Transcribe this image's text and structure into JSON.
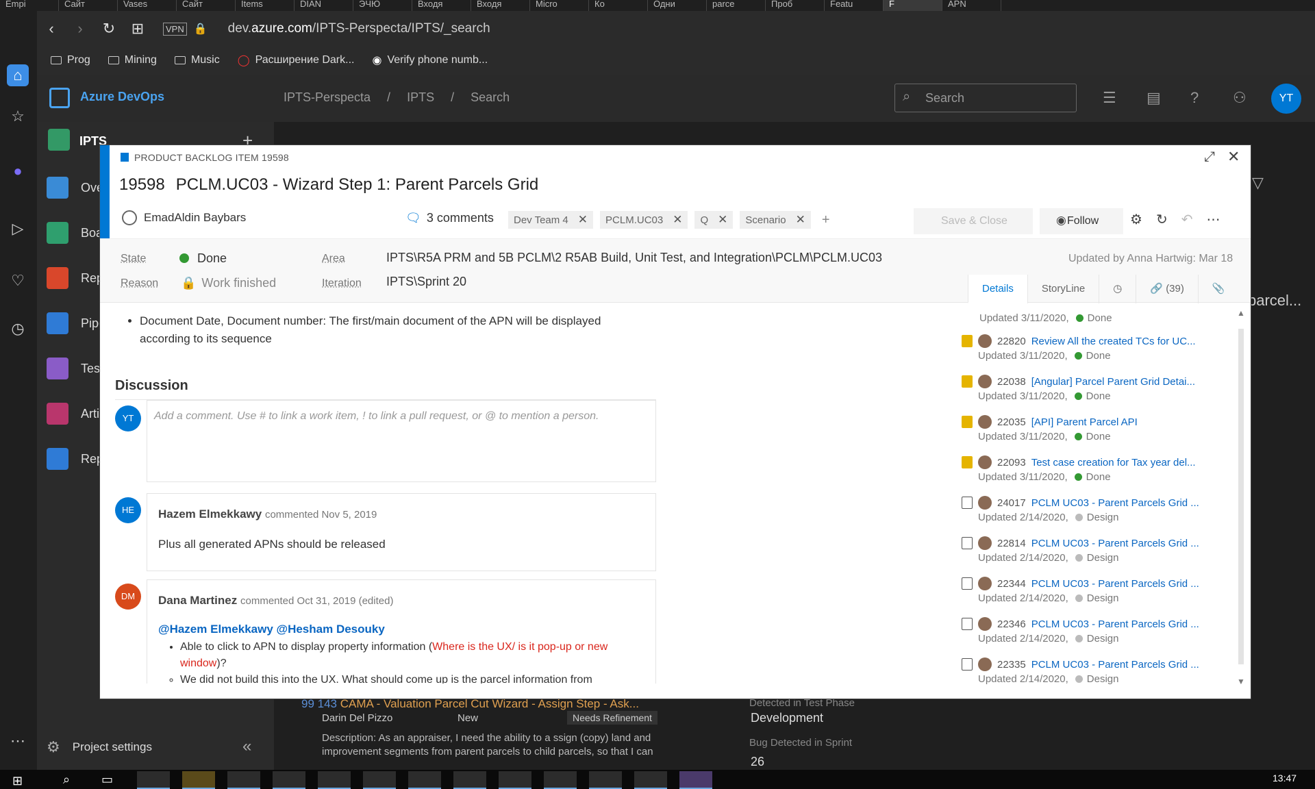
{
  "browser": {
    "url_prefix": "dev.",
    "url_domain": "azure.com",
    "url_path": "/IPTS-Perspecta/IPTS/_search",
    "vpn": "VPN",
    "tabs": [
      "Empi",
      "Сайт",
      "Vases",
      "Сайт",
      "Items",
      "DIAN",
      "ЭЧЮ",
      "Входя",
      "Входя",
      "Micro",
      "Ко",
      "Одни",
      "parce",
      "Проб",
      "Featu",
      "F",
      "APN"
    ],
    "bookmarks": [
      "Prog",
      "Mining",
      "Music",
      "Расширение Dark...",
      "Verify phone numb..."
    ]
  },
  "ado": {
    "brand": "Azure DevOps",
    "breadcrumb": [
      "IPTS-Perspecta",
      "IPTS",
      "Search"
    ],
    "search_placeholder": "Search",
    "avatar_initials": "YT",
    "project": "IPTS",
    "nav": [
      "Ove",
      "Boa",
      "Rep",
      "Pipe",
      "Test",
      "Arti",
      "Rep"
    ],
    "project_settings": "Project settings",
    "bg_text": {
      "item_prefix": "99 143",
      "item_title": "CAMA - Valuation Parcel Cut Wizard - Assign Step - Ask...",
      "assignee": "Darin Del Pizzo",
      "state": "New",
      "tag": "Needs Refinement",
      "desc": "Description: As an appraiser, I need the ability to a ssign (copy) land and improvement segments from parent parcels to child parcels, so that I can",
      "field1_label": "Detected in Test Phase",
      "field1_value": "Development",
      "field2_label": "Bug Detected in Sprint",
      "field2_value": "26",
      "right_title": "parcel..."
    }
  },
  "work_item": {
    "type_label": "PRODUCT BACKLOG ITEM 19598",
    "id": "19598",
    "title": "PCLM.UC03 - Wizard Step 1: Parent Parcels Grid",
    "assigned_to": "EmadAldin Baybars",
    "comments": "3 comments",
    "tags": [
      "Dev Team 4",
      "PCLM.UC03",
      "Q",
      "Scenario"
    ],
    "save_label": "Save & Close",
    "follow_label": "Follow",
    "state_label": "State",
    "state_value": "Done",
    "reason_label": "Reason",
    "reason_value": "Work finished",
    "area_label": "Area",
    "area_value": "IPTS\\R5A PRM and 5B PCLM\\2 R5AB Build, Unit Test, and Integration\\PCLM\\PCLM.UC03",
    "iteration_label": "Iteration",
    "iteration_value": "IPTS\\Sprint 20",
    "updated_by": "Updated by Anna Hartwig: Mar 18",
    "detail_tabs": [
      "Details",
      "StoryLine",
      "(39)"
    ],
    "bullet": "Document Date, Document number: The first/main document of the APN will be displayed according to its sequence",
    "discussion_title": "Discussion",
    "add_comment_placeholder": "Add a comment. Use # to link a work item, ! to link a pull request, or @ to mention a person.",
    "my_initials": "YT",
    "comments_list": [
      {
        "initials": "HE",
        "author": "Hazem Elmekkawy",
        "meta": "commented Nov 5, 2019",
        "text": "Plus all generated APNs should be released",
        "color": "#0078d4"
      },
      {
        "initials": "DM",
        "author": "Dana Martinez",
        "meta": "commented Oct 31, 2019 (edited)",
        "mentions": "@Hazem Elmekkawy @Hesham Desouky",
        "bullet_a": "Able to click to APN to display property information (",
        "bullet_red": "Where is the UX/ is it pop-up or new window",
        "bullet_b": ")?",
        "sub": "We did not build this into the UX. What should come up is the parcel information from",
        "color": "#d84a1b"
      }
    ],
    "links": [
      {
        "id": "22820",
        "title": "Review All the created TCs for UC...",
        "updated": "Updated 3/11/2020,",
        "state": "Done",
        "state_color": "#339933",
        "kind": "task"
      },
      {
        "id": "22038",
        "title": "[Angular] Parcel Parent Grid Detai...",
        "updated": "Updated 3/11/2020,",
        "state": "Done",
        "state_color": "#339933",
        "kind": "task"
      },
      {
        "id": "22035",
        "title": "[API] Parent Parcel API",
        "updated": "Updated 3/11/2020,",
        "state": "Done",
        "state_color": "#339933",
        "kind": "task"
      },
      {
        "id": "22093",
        "title": "Test case creation for Tax year del...",
        "updated": "Updated 3/11/2020,",
        "state": "Done",
        "state_color": "#339933",
        "kind": "task"
      },
      {
        "id": "24017",
        "title": "PCLM UC03 - Parent Parcels Grid ...",
        "updated": "Updated 2/14/2020,",
        "state": "Design",
        "state_color": "#bbbbbb",
        "kind": "test"
      },
      {
        "id": "22814",
        "title": "PCLM UC03 - Parent Parcels Grid ...",
        "updated": "Updated 2/14/2020,",
        "state": "Design",
        "state_color": "#bbbbbb",
        "kind": "test"
      },
      {
        "id": "22344",
        "title": "PCLM UC03 - Parent Parcels Grid ...",
        "updated": "Updated 2/14/2020,",
        "state": "Design",
        "state_color": "#bbbbbb",
        "kind": "test"
      },
      {
        "id": "22346",
        "title": "PCLM UC03 - Parent Parcels Grid ...",
        "updated": "Updated 2/14/2020,",
        "state": "Design",
        "state_color": "#bbbbbb",
        "kind": "test"
      },
      {
        "id": "22335",
        "title": "PCLM UC03 - Parent Parcels Grid ...",
        "updated": "Updated 2/14/2020,",
        "state": "Design",
        "state_color": "#bbbbbb",
        "kind": "test"
      }
    ],
    "first_link_partial": {
      "updated": "Updated 3/11/2020,",
      "state": "Done"
    }
  },
  "taskbar": {
    "clock": "13:47"
  }
}
